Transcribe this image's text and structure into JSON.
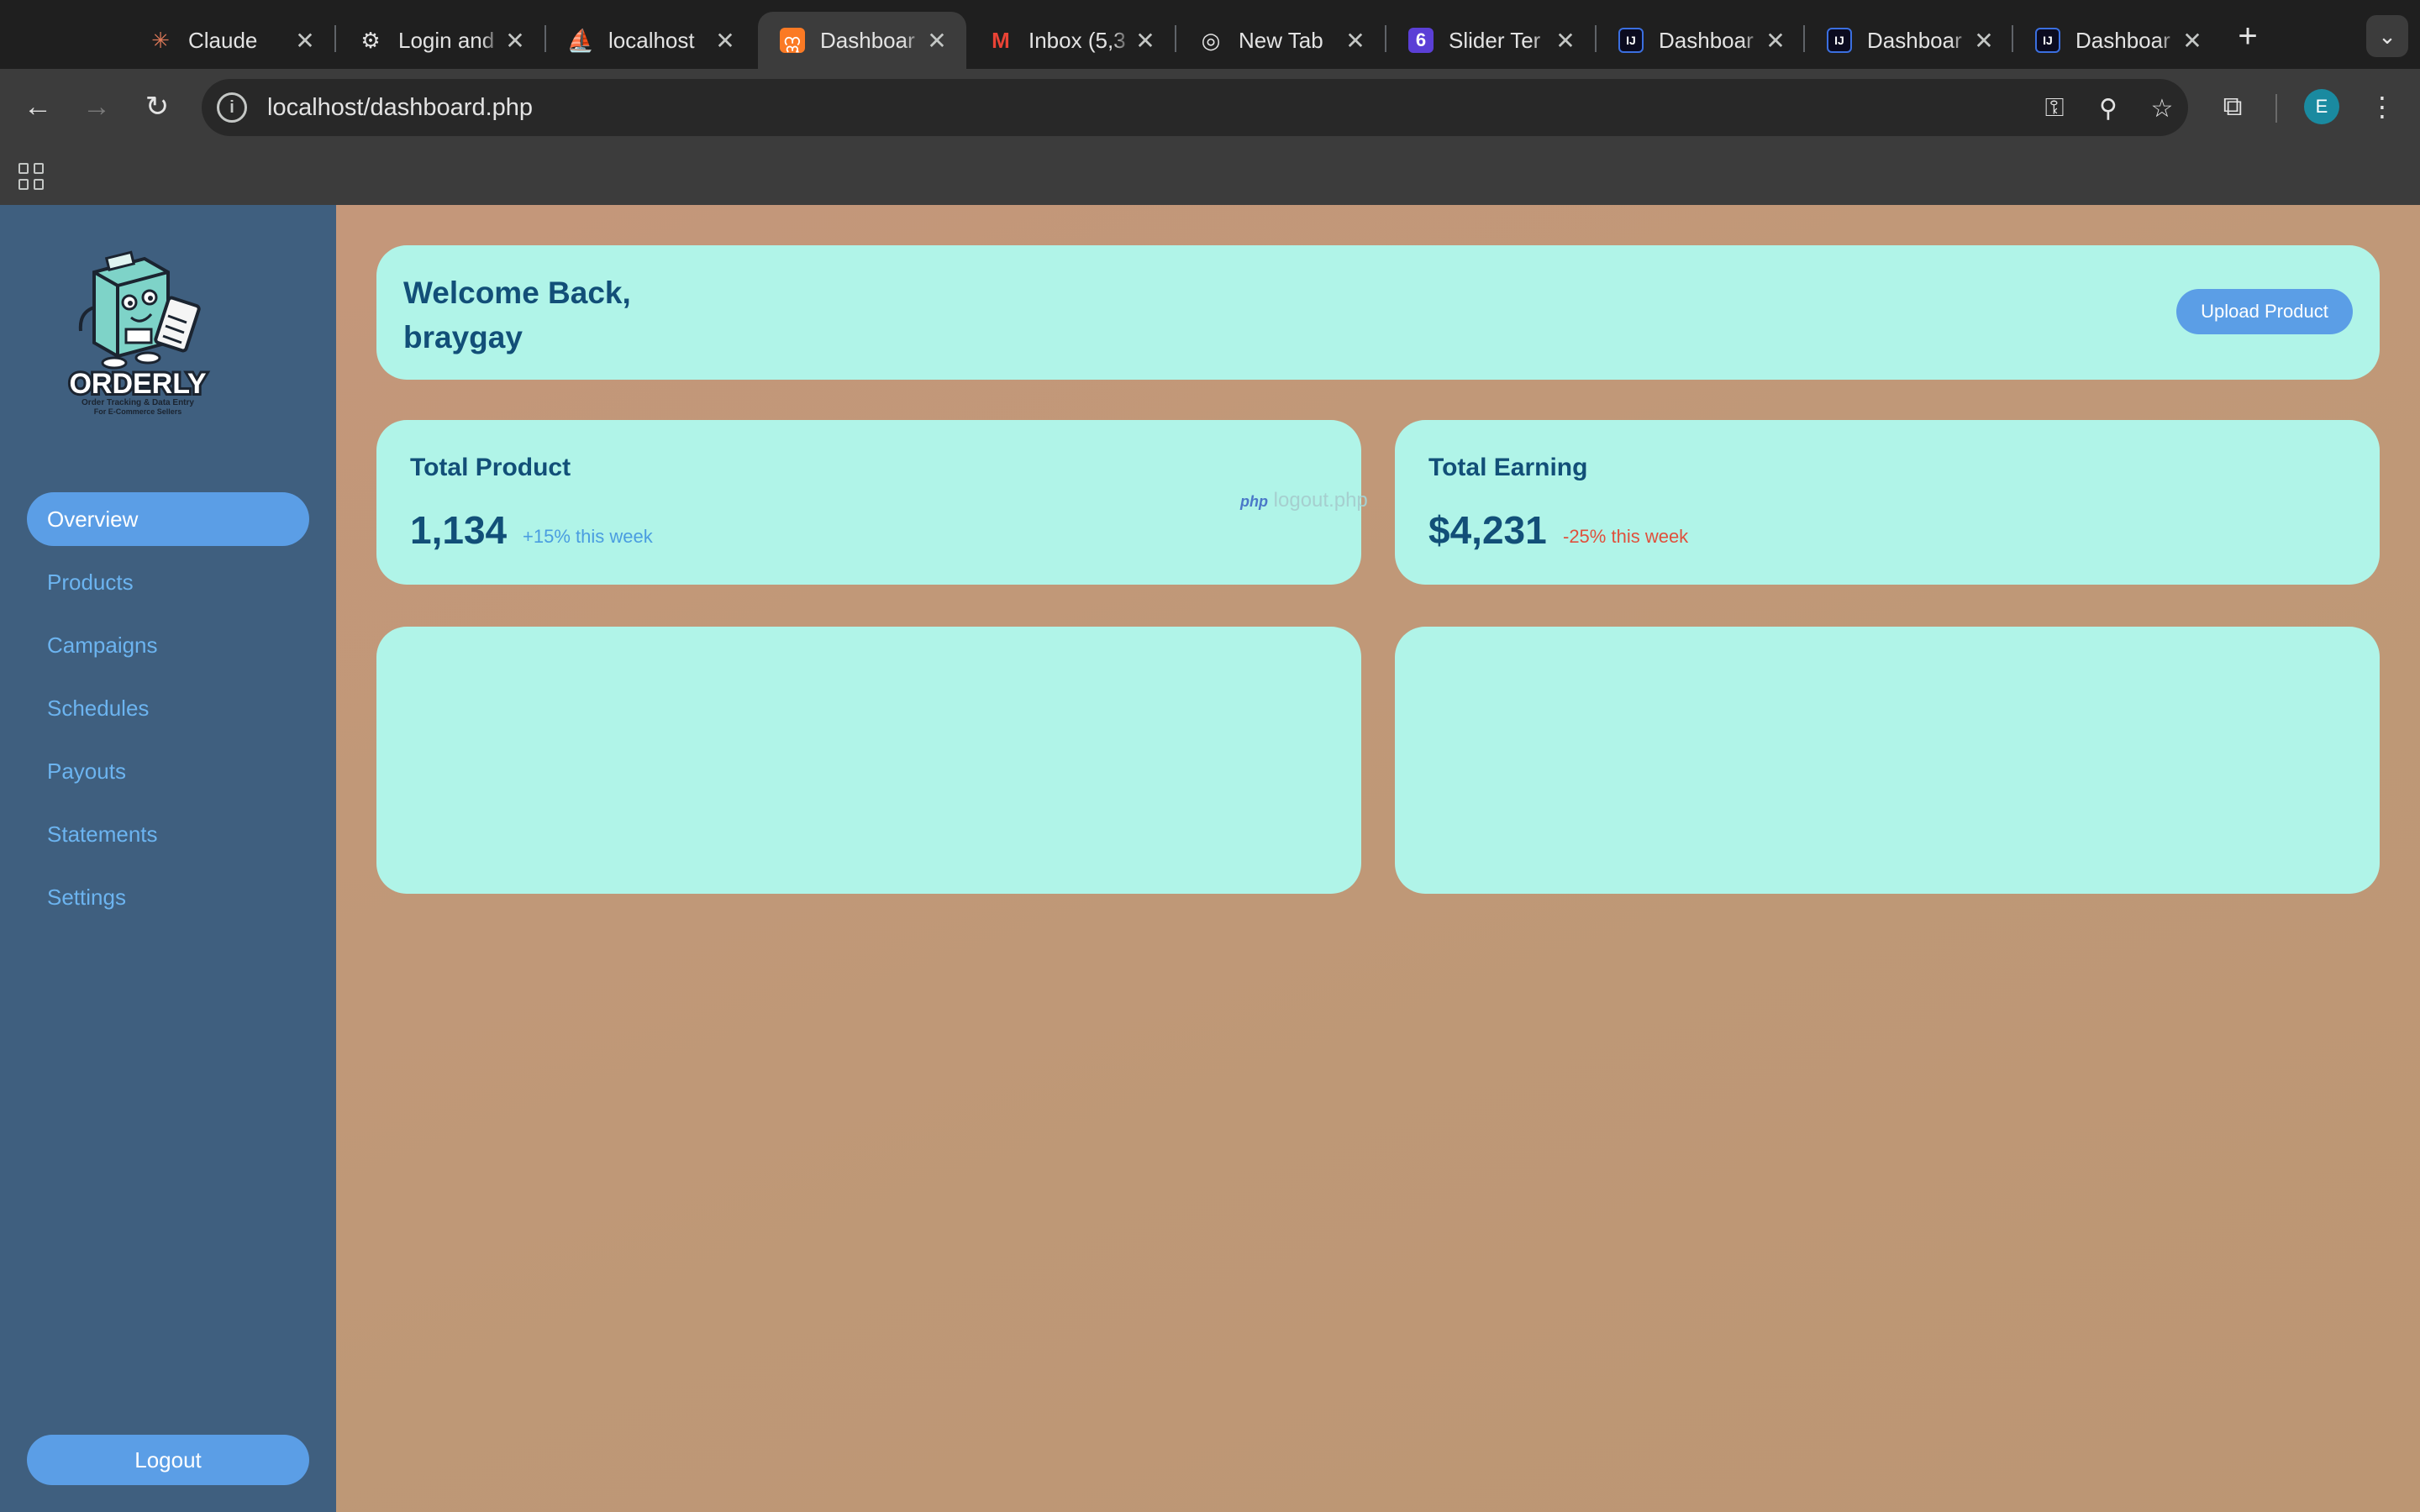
{
  "browser": {
    "tabs": [
      {
        "title": "Claude",
        "icon": "claude-icon",
        "active": false
      },
      {
        "title": "Login and",
        "icon": "openai-icon",
        "active": false
      },
      {
        "title": "localhost",
        "icon": "phpmyadmin-icon",
        "active": false
      },
      {
        "title": "Dashboar",
        "icon": "xampp-icon",
        "active": true
      },
      {
        "title": "Inbox (5,3",
        "icon": "gmail-icon",
        "active": false
      },
      {
        "title": "New Tab",
        "icon": "chrome-icon",
        "active": false
      },
      {
        "title": "Slider Ter",
        "icon": "six-icon",
        "active": false
      },
      {
        "title": "Dashboar",
        "icon": "intellij-icon",
        "active": false
      },
      {
        "title": "Dashboar",
        "icon": "intellij-icon",
        "active": false
      },
      {
        "title": "Dashboar",
        "icon": "intellij-icon",
        "active": false
      }
    ],
    "url": "localhost/dashboard.php",
    "profile_initial": "E"
  },
  "sidebar": {
    "logo": {
      "name": "ORDERLY",
      "tagline_1": "Order Tracking & Data Entry",
      "tagline_2": "For E-Commerce Sellers"
    },
    "items": [
      {
        "label": "Overview",
        "active": true
      },
      {
        "label": "Products",
        "active": false
      },
      {
        "label": "Campaigns",
        "active": false
      },
      {
        "label": "Schedules",
        "active": false
      },
      {
        "label": "Payouts",
        "active": false
      },
      {
        "label": "Statements",
        "active": false
      },
      {
        "label": "Settings",
        "active": false
      }
    ],
    "logout_label": "Logout"
  },
  "header": {
    "welcome_line1": "Welcome Back,",
    "username": "braygay",
    "upload_label": "Upload Product"
  },
  "stats": {
    "total_product": {
      "title": "Total Product",
      "value": "1,134",
      "change": "+15% this week"
    },
    "total_earning": {
      "title": "Total Earning",
      "value": "$4,231",
      "change": "-25% this week"
    },
    "drag_ghost": {
      "badge": "php",
      "filename": "logout.php"
    }
  },
  "colors": {
    "sidebar_bg": "#3f5f7f",
    "accent": "#5b9ee6",
    "card_bg": "#b0f4e8",
    "heading": "#124f78",
    "positive": "#4a9de0",
    "negative": "#e0503c"
  }
}
